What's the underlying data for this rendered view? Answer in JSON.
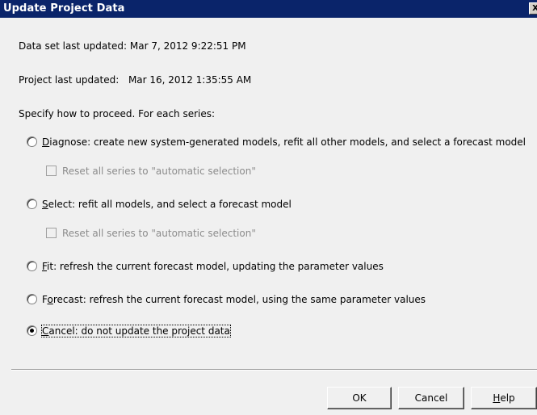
{
  "window": {
    "title": "Update Project Data",
    "close_glyph": "X"
  },
  "info": {
    "dataset_label": "Data set last updated:",
    "dataset_value": "Mar 7, 2012 9:22:51 PM",
    "project_label": "Project last updated:",
    "project_value": "Mar 16, 2012 1:35:55 AM",
    "instruction": "Specify how to proceed. For each series:"
  },
  "options": {
    "diagnose": {
      "mnemonic": "D",
      "rest": "iagnose: create new system-generated models, refit all other models, and select a forecast model",
      "checked": false
    },
    "diagnose_reset": {
      "label": "Reset all series to \"automatic selection\"",
      "enabled": false,
      "checked": false
    },
    "select": {
      "mnemonic": "S",
      "rest": "elect: refit all models, and select a forecast model",
      "checked": false
    },
    "select_reset": {
      "label": "Reset all series to \"automatic selection\"",
      "enabled": false,
      "checked": false
    },
    "fit": {
      "mnemonic": "F",
      "rest": "it: refresh the current forecast model, updating the parameter values",
      "checked": false
    },
    "forecast": {
      "prefix": "F",
      "mnemonic": "o",
      "rest": "recast: refresh the current forecast model, using the same parameter values",
      "checked": false
    },
    "cancel": {
      "mnemonic": "C",
      "rest": "ancel: do not update the project data",
      "checked": true
    }
  },
  "buttons": {
    "ok": "OK",
    "cancel": "Cancel",
    "help_mnemonic": "H",
    "help_rest": "elp"
  }
}
